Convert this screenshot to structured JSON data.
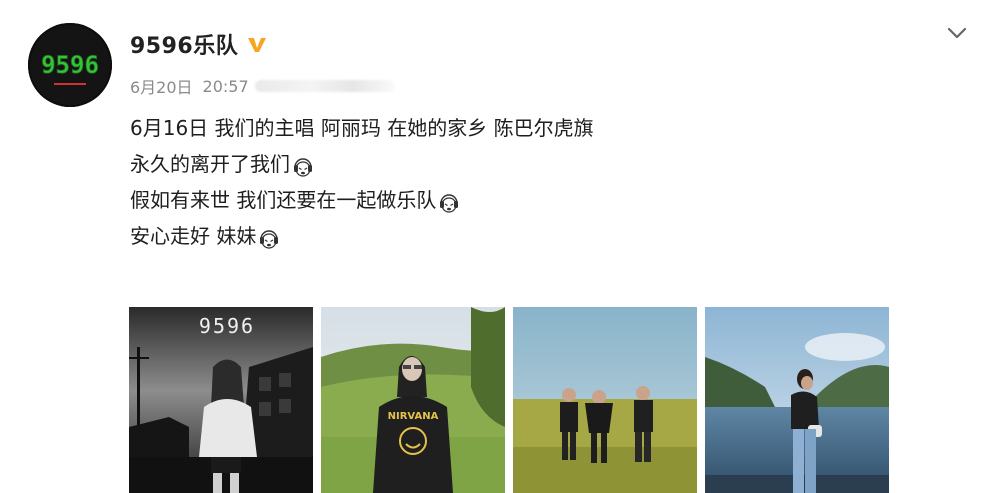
{
  "user": {
    "name": "9596乐队",
    "avatar_text": "9596",
    "verified_icon": "verified-badge-icon"
  },
  "post": {
    "date": "6月20日",
    "time": "20:57",
    "lines": [
      "6月16日 我们的主唱 阿丽玛 在她的家乡 陈巴尔虎旗",
      "永久的离开了我们",
      "假如有来世 我们还要在一起做乐队",
      "安心走好 妹妹"
    ],
    "emoji_icon": "crying-face-icon"
  },
  "gallery": {
    "photo1_text": "9596",
    "photo2_text": "NIRVANA"
  },
  "colors": {
    "verified": "#f5a623",
    "avatar_green": "#38c23a",
    "text": "#1e1e1e",
    "meta": "#8a8a8a"
  }
}
